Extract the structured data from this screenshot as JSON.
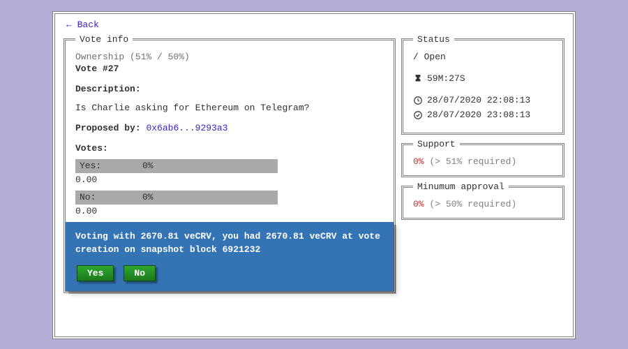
{
  "nav": {
    "back_label": "← Back"
  },
  "vote_info": {
    "legend": "Vote info",
    "ownership": "Ownership (51% / 50%)",
    "vote_id": "Vote #27",
    "description_header": "Description:",
    "description_text": "Is Charlie asking for Ethereum on Telegram?",
    "proposed_by_label": "Proposed by:",
    "proposed_by_addr": "0x6ab6...9293a3",
    "votes_header": "Votes:",
    "votes": [
      {
        "label": "Yes:",
        "pct": "0%",
        "amount": "0.00"
      },
      {
        "label": "No:",
        "pct": "0%",
        "amount": "0.00"
      }
    ]
  },
  "vote_box": {
    "message": "Voting with 2670.81 veCRV, you had 2670.81 veCRV at vote creation on snapshot block 6921232",
    "yes_label": "Yes",
    "no_label": "No"
  },
  "status": {
    "legend": "Status",
    "state": "Open",
    "remaining": "59M:27S",
    "start_time": "28/07/2020 22:08:13",
    "end_time": "28/07/2020 23:08:13"
  },
  "support": {
    "legend": "Support",
    "pct": "0%",
    "req": "(> 51% required)"
  },
  "min_approval": {
    "legend": "Minumum approval",
    "pct": "0%",
    "req": "(> 50% required)"
  }
}
